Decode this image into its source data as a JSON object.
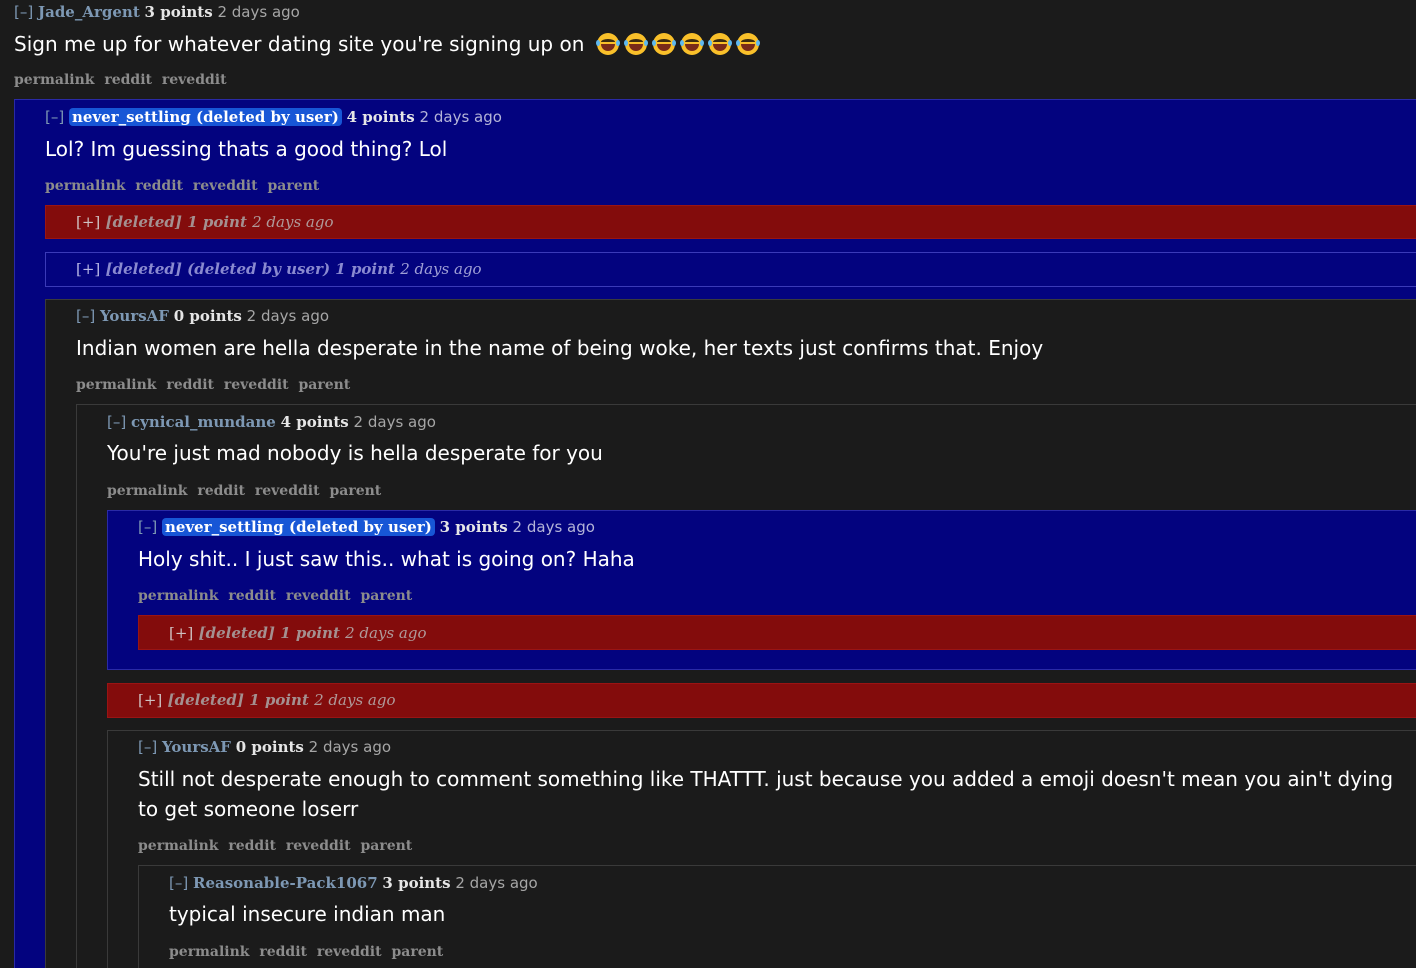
{
  "common": {
    "collapse": "[–]",
    "expand": "[+]",
    "permalink": "permalink",
    "reddit": "reddit",
    "reveddit": "reveddit",
    "parent": "parent"
  },
  "c1": {
    "user": "Jade_Argent",
    "points": "3 points",
    "time": "2 days ago",
    "text": "Sign me up for whatever dating site you're signing up on",
    "emoji_count": 6,
    "emoji_name": "laughing-crying-emoji-icon"
  },
  "c2": {
    "user": "never_settling (deleted by user)",
    "points": "4 points",
    "time": "2 days ago",
    "text": "Lol? Im guessing thats a good thing? Lol"
  },
  "d1": {
    "user": "[deleted]",
    "points": "1 point",
    "time": "2 days ago"
  },
  "d2": {
    "user": "[deleted] (deleted by user)",
    "points": "1 point",
    "time": "2 days ago"
  },
  "c3": {
    "user": "YoursAF",
    "points": "0 points",
    "time": "2 days ago",
    "text": "Indian women are hella desperate in the name of being woke, her texts just confirms that. Enjoy"
  },
  "c4": {
    "user": "cynical_mundane",
    "points": "4 points",
    "time": "2 days ago",
    "text": "You're just mad nobody is hella desperate for you"
  },
  "c5": {
    "user": "never_settling (deleted by user)",
    "points": "3 points",
    "time": "2 days ago",
    "text": "Holy shit.. I just saw this.. what is going on? Haha"
  },
  "d3": {
    "user": "[deleted]",
    "points": "1 point",
    "time": "2 days ago"
  },
  "d4": {
    "user": "[deleted]",
    "points": "1 point",
    "time": "2 days ago"
  },
  "c6": {
    "user": "YoursAF",
    "points": "0 points",
    "time": "2 days ago",
    "text": "Still not desperate enough to comment something like THATTT. just because you added a emoji doesn't mean you ain't dying to get someone loserr"
  },
  "c7": {
    "user": "Reasonable-Pack1067",
    "points": "3 points",
    "time": "2 days ago",
    "text": "typical insecure indian man"
  },
  "colors": {
    "background": "#1b1b1b",
    "highlight_blue": "#03037f",
    "deleted_red": "#830c0c",
    "username": "#7d98b4",
    "op_badge": "#1756d6"
  }
}
